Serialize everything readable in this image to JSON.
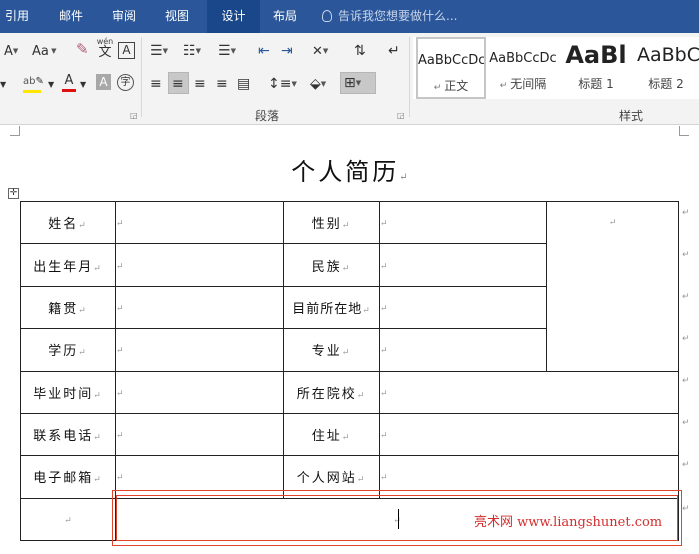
{
  "ribbon_tabs": [
    {
      "label": "引用",
      "active": false
    },
    {
      "label": "邮件",
      "active": false
    },
    {
      "label": "审阅",
      "active": false
    },
    {
      "label": "视图",
      "active": false
    },
    {
      "label": "设计",
      "active": true
    },
    {
      "label": "布局",
      "active": false
    }
  ],
  "tell_me": "告诉我您想要做什么...",
  "font_group": {
    "font_size_aa": "Aa",
    "wen_label": "wén",
    "wen_char": "文",
    "char_border": "A",
    "char_a": "A",
    "char_shading": "A",
    "enclosed_char": "字"
  },
  "paragraph_group": {
    "label": "段落"
  },
  "styles_group": {
    "label": "样式",
    "items": [
      {
        "preview": "AaBbCcDc",
        "name": "正文",
        "selected": true
      },
      {
        "preview": "AaBbCcDc",
        "name": "无间隔",
        "selected": false
      },
      {
        "preview": "AaBl",
        "name": "标题 1",
        "selected": false
      },
      {
        "preview": "AaBbC",
        "name": "标题 2",
        "selected": false
      }
    ]
  },
  "colors": {
    "tabbar": "#2b579a",
    "highlight": "#ffe600",
    "font_color": "#e01010",
    "selection_border": "#e0452b",
    "watermark": "#d42c2c"
  },
  "document": {
    "title": "个人简历",
    "paragraph_mark": "↵",
    "table": {
      "rows": [
        {
          "l1": "姓名",
          "l2": "性别"
        },
        {
          "l1": "出生年月",
          "l2": "民族"
        },
        {
          "l1": "籍贯",
          "l2": "目前所在地"
        },
        {
          "l1": "学历",
          "l2": "专业"
        },
        {
          "l1": "毕业时间",
          "l2": "所在院校"
        },
        {
          "l1": "联系电话",
          "l2": "住址"
        },
        {
          "l1": "电子邮箱",
          "l2": "个人网站"
        }
      ]
    },
    "watermark": "亮术网 www.liangshunet.com"
  }
}
